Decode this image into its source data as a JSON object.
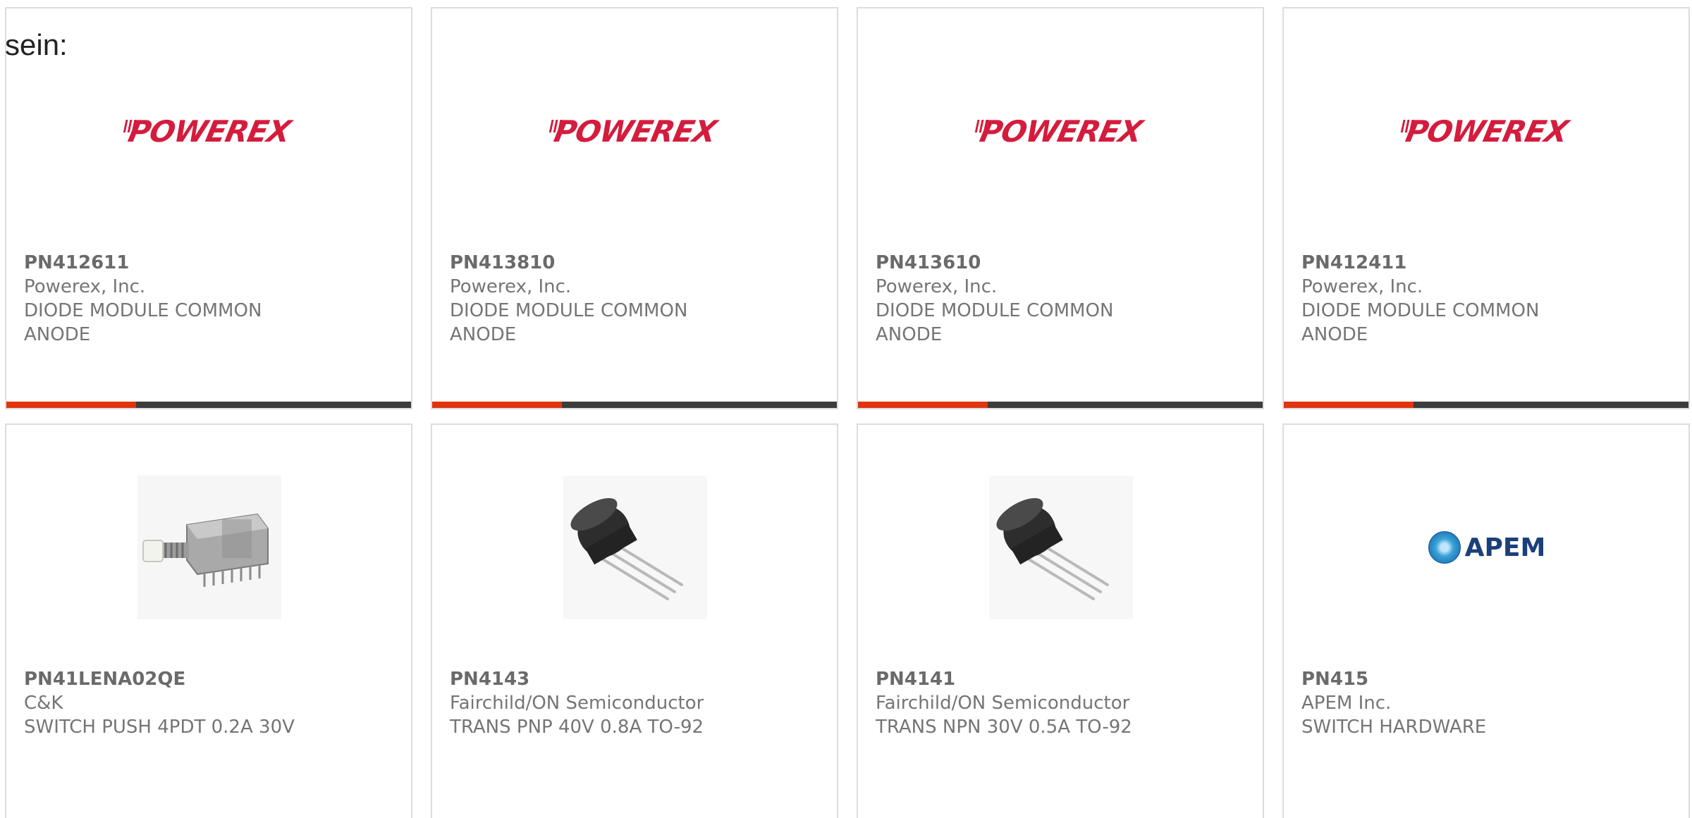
{
  "lead_text": "sein:",
  "cards": [
    {
      "part": "PN412611",
      "manufacturer": "Powerex, Inc.",
      "description": "DIODE MODULE COMMON\nANODE",
      "image": "powerex-logo",
      "logo_text": "POWEREX",
      "progress": 0.32
    },
    {
      "part": "PN413810",
      "manufacturer": "Powerex, Inc.",
      "description": "DIODE MODULE COMMON\nANODE",
      "image": "powerex-logo",
      "logo_text": "POWEREX",
      "progress": 0.32
    },
    {
      "part": "PN413610",
      "manufacturer": "Powerex, Inc.",
      "description": "DIODE MODULE COMMON\nANODE",
      "image": "powerex-logo",
      "logo_text": "POWEREX",
      "progress": 0.32
    },
    {
      "part": "PN412411",
      "manufacturer": "Powerex, Inc.",
      "description": "DIODE MODULE COMMON\nANODE",
      "image": "powerex-logo",
      "logo_text": "POWEREX",
      "progress": 0.32
    },
    {
      "part": "PN41LENA02QE",
      "manufacturer": "C&K",
      "description": "SWITCH PUSH 4PDT 0.2A 30V",
      "image": "push-switch-photo"
    },
    {
      "part": "PN4143",
      "manufacturer": "Fairchild/ON Semiconductor",
      "description": "TRANS PNP 40V 0.8A TO-92",
      "image": "to92-transistor-photo"
    },
    {
      "part": "PN4141",
      "manufacturer": "Fairchild/ON Semiconductor",
      "description": "TRANS NPN 30V 0.5A TO-92",
      "image": "to92-transistor-photo"
    },
    {
      "part": "PN415",
      "manufacturer": "APEM Inc.",
      "description": "SWITCH HARDWARE",
      "image": "apem-logo",
      "logo_text": "APEM"
    }
  ],
  "colors": {
    "progress_fill": "#e0340f",
    "progress_track": "#3c3c3c",
    "powerex_red": "#d41c3d",
    "apem_blue": "#1b3f7a"
  }
}
